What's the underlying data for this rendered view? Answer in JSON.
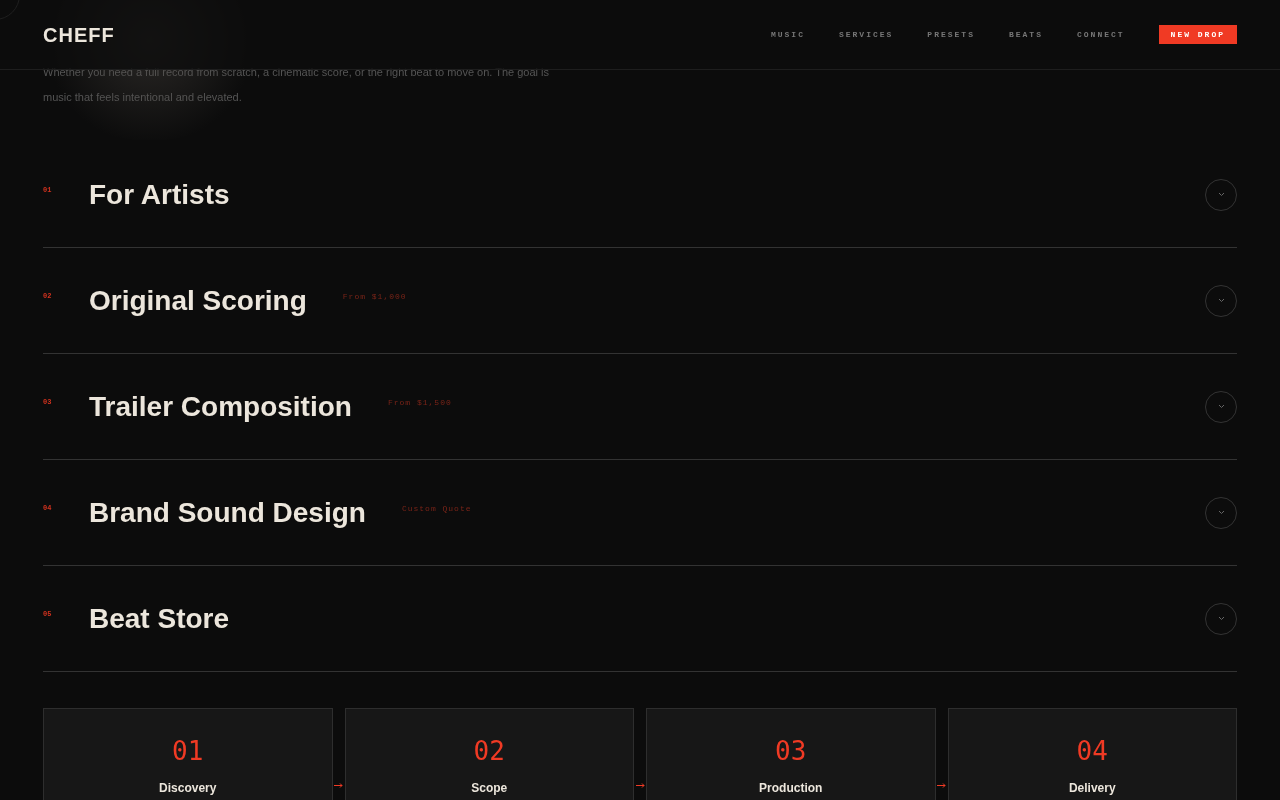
{
  "header": {
    "logo": "CHEFF",
    "nav": [
      "MUSIC",
      "SERVICES",
      "PRESETS",
      "BEATS",
      "CONNECT"
    ],
    "cta": "NEW DROP"
  },
  "intro": "Whether you need a full record from scratch, a cinematic score, or the right beat to move on. The goal is music that feels intentional and elevated.",
  "services": [
    {
      "number": "01",
      "title": "For Artists",
      "expanded": false
    },
    {
      "number": "02",
      "title": "Original Scoring",
      "price": "From $1,000",
      "expanded": false
    },
    {
      "number": "03",
      "title": "Trailer Composition",
      "price": "From $1,500",
      "expanded": false
    },
    {
      "number": "04",
      "title": "Brand Sound Design",
      "price": "Custom Quote",
      "expanded": false
    },
    {
      "number": "05",
      "title": "Beat Store",
      "expanded": false
    }
  ],
  "process": [
    {
      "number": "01",
      "title": "Discovery"
    },
    {
      "number": "02",
      "title": "Scope"
    },
    {
      "number": "03",
      "title": "Production"
    },
    {
      "number": "04",
      "title": "Delivery"
    }
  ]
}
